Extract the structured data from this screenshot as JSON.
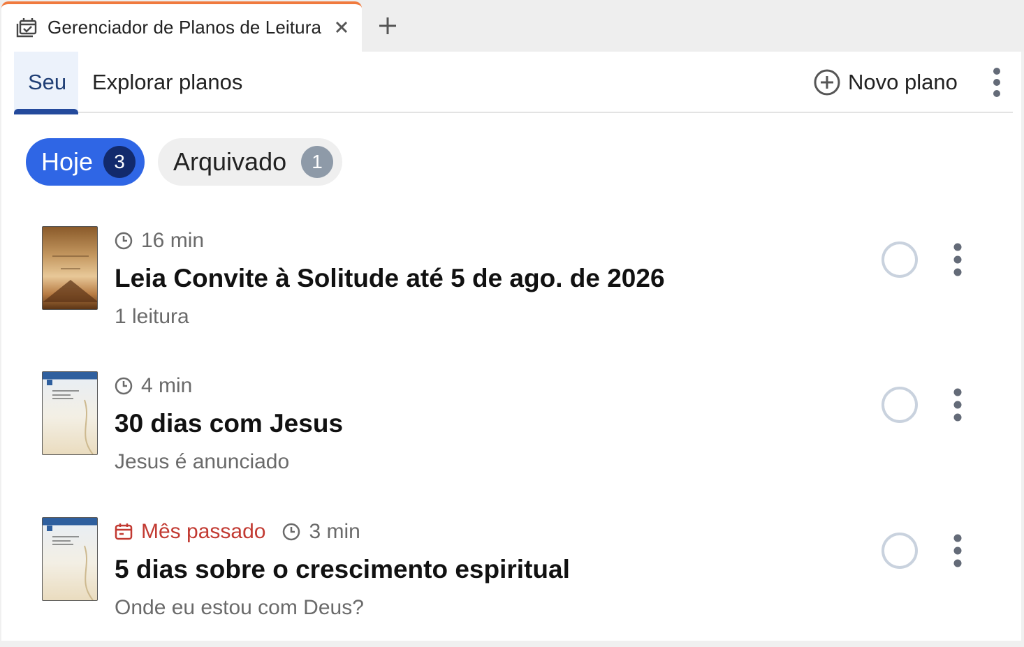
{
  "browser": {
    "tab_title": "Gerenciador de Planos de Leitura",
    "tab_icon": "calendar-stack-icon",
    "accent": "#f07a3e"
  },
  "nav": {
    "tabs": [
      {
        "label": "Seu",
        "active": true
      },
      {
        "label": "Explorar planos",
        "active": false
      }
    ],
    "new_plan_label": "Novo plano"
  },
  "filters": {
    "today": {
      "label": "Hoje",
      "count": "3"
    },
    "archived": {
      "label": "Arquivado",
      "count": "1"
    }
  },
  "plans": [
    {
      "duration": "16 min",
      "title": "Leia Convite à Solitude até 5 de ago. de 2026",
      "subtitle": "1 leitura",
      "cover": "brown-book-cover"
    },
    {
      "duration": "4 min",
      "title": "30 dias com Jesus",
      "subtitle": "Jesus é anunciado",
      "cover": "blue-bible-cover"
    },
    {
      "overdue": "Mês passado",
      "duration": "3 min",
      "title": "5 dias sobre o crescimento espiritual",
      "subtitle": "Onde eu estou com Deus?",
      "cover": "blue-bible-cover"
    }
  ],
  "colors": {
    "primary": "#2f66e5",
    "primary_dark": "#122a6c",
    "overdue": "#c23a32"
  }
}
